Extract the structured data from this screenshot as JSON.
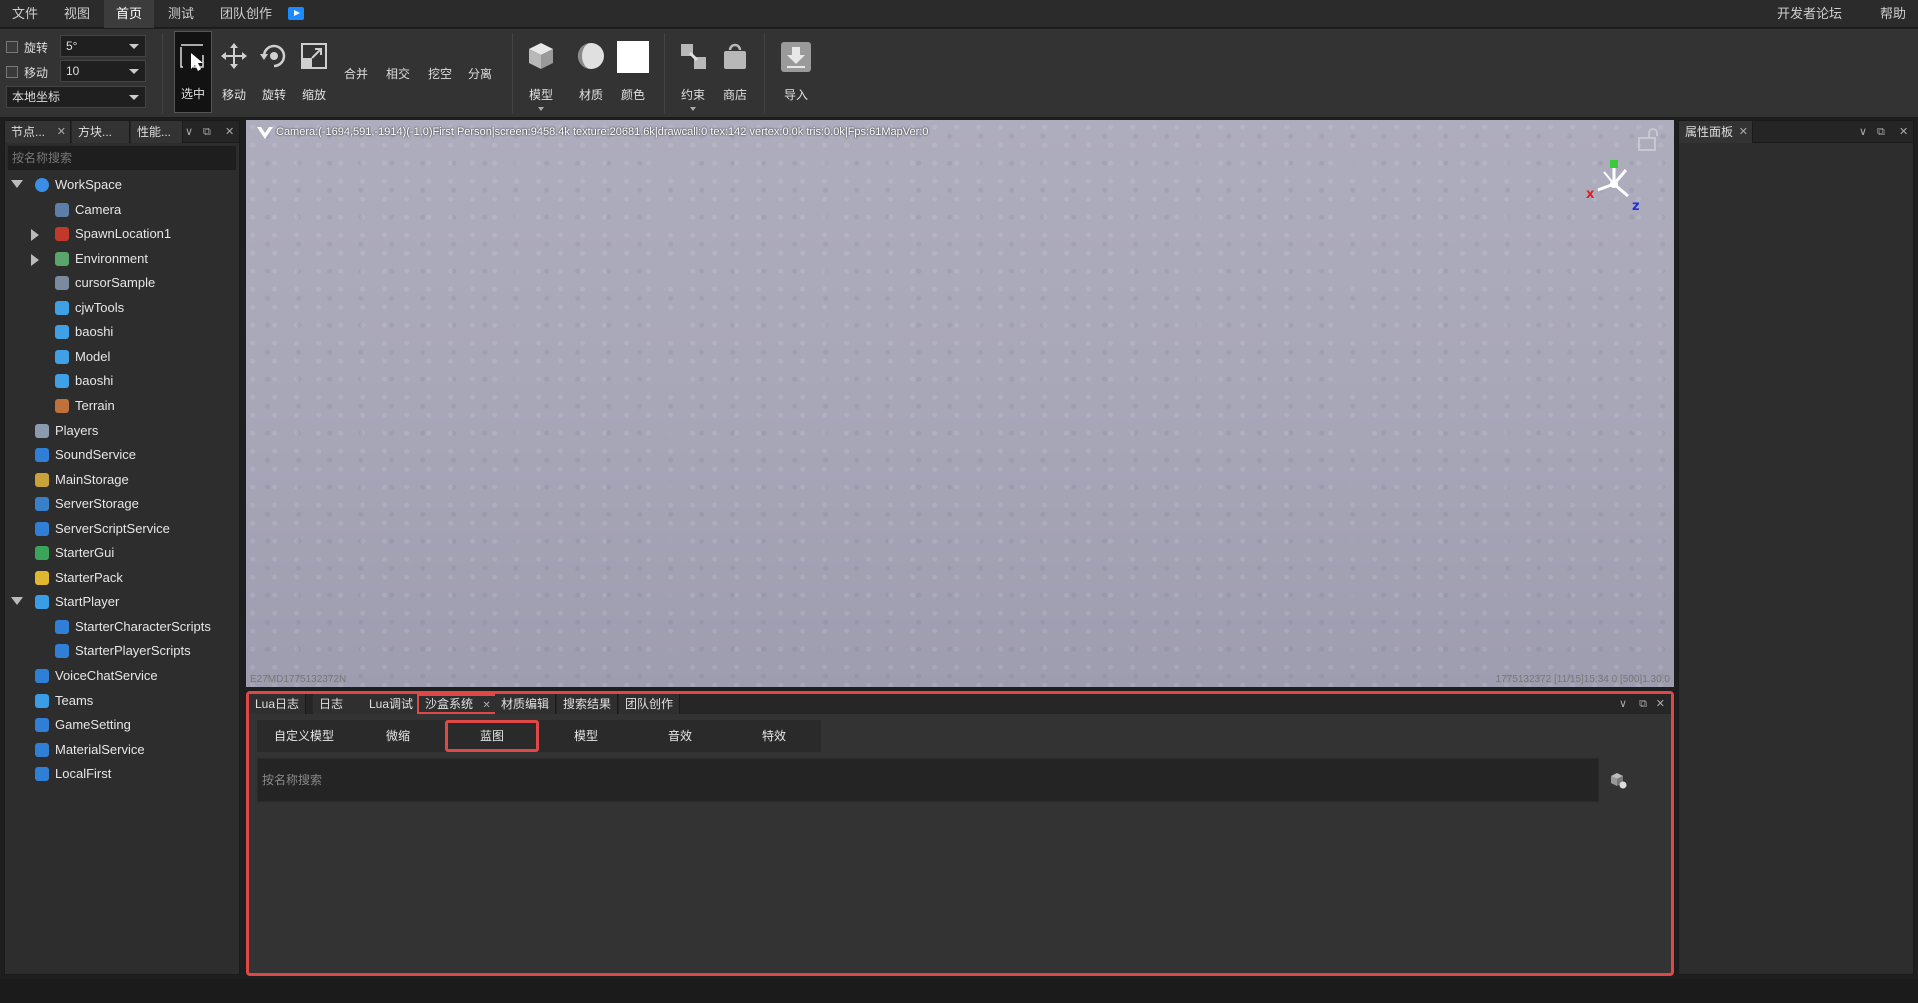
{
  "menu": {
    "file": "文件",
    "view": "视图",
    "home": "首页",
    "test": "测试",
    "team": "团队创作",
    "forum": "开发者论坛",
    "help": "帮助"
  },
  "toolbar": {
    "rotate_label": "旋转",
    "rotate_value": "5°",
    "move_label": "移动",
    "move_value": "10",
    "coord_value": "本地坐标",
    "select": "选中",
    "move": "移动",
    "rotate": "旋转",
    "scale": "缩放",
    "union": "合并",
    "intersect": "相交",
    "negate": "挖空",
    "separate": "分离",
    "model": "模型",
    "material": "材质",
    "color": "颜色",
    "constraint": "约束",
    "store": "商店",
    "import": "导入"
  },
  "left_panel": {
    "tabs": [
      "节点...",
      "方块...",
      "性能..."
    ],
    "search_placeholder": "按名称搜索",
    "tree": [
      {
        "label": "WorkSpace",
        "level": 0,
        "twisty": "down",
        "icon": "globe-icon",
        "color": "#3a8ee6"
      },
      {
        "label": "Camera",
        "level": 1,
        "twisty": "",
        "icon": "camera-icon",
        "color": "#5b7fa8"
      },
      {
        "label": "SpawnLocation1",
        "level": 1,
        "twisty": "right",
        "icon": "spawn-icon",
        "color": "#c0392b"
      },
      {
        "label": "Environment",
        "level": 1,
        "twisty": "right",
        "icon": "mountain-icon",
        "color": "#5aa56b"
      },
      {
        "label": "cursorSample",
        "level": 1,
        "twisty": "",
        "icon": "model-icon",
        "color": "#7a8ba0"
      },
      {
        "label": "cjwTools",
        "level": 1,
        "twisty": "",
        "icon": "folder-icon",
        "color": "#3fa0e6"
      },
      {
        "label": "baoshi",
        "level": 1,
        "twisty": "",
        "icon": "folder-icon",
        "color": "#3fa0e6"
      },
      {
        "label": "Model",
        "level": 1,
        "twisty": "",
        "icon": "folder-icon",
        "color": "#3fa0e6"
      },
      {
        "label": "baoshi",
        "level": 1,
        "twisty": "",
        "icon": "folder-icon",
        "color": "#3fa0e6"
      },
      {
        "label": "Terrain",
        "level": 1,
        "twisty": "",
        "icon": "terrain-icon",
        "color": "#c0703a"
      },
      {
        "label": "Players",
        "level": 0,
        "twisty": "",
        "icon": "players-icon",
        "color": "#8a9bb0"
      },
      {
        "label": "SoundService",
        "level": 0,
        "twisty": "",
        "icon": "sound-icon",
        "color": "#2f7fd6"
      },
      {
        "label": "MainStorage",
        "level": 0,
        "twisty": "",
        "icon": "storage-icon",
        "color": "#c9a23a"
      },
      {
        "label": "ServerStorage",
        "level": 0,
        "twisty": "",
        "icon": "server-storage-icon",
        "color": "#3a7fc9"
      },
      {
        "label": "ServerScriptService",
        "level": 0,
        "twisty": "",
        "icon": "script-service-icon",
        "color": "#2f7fd6"
      },
      {
        "label": "StarterGui",
        "level": 0,
        "twisty": "",
        "icon": "gui-icon",
        "color": "#3aa55a"
      },
      {
        "label": "StarterPack",
        "level": 0,
        "twisty": "",
        "icon": "pack-icon",
        "color": "#e0b830"
      },
      {
        "label": "StartPlayer",
        "level": 0,
        "twisty": "down",
        "icon": "player-icon",
        "color": "#3a9ee6"
      },
      {
        "label": "StarterCharacterScripts",
        "level": 1,
        "twisty": "",
        "icon": "script-icon",
        "color": "#2f7fd6"
      },
      {
        "label": "StarterPlayerScripts",
        "level": 1,
        "twisty": "",
        "icon": "script-icon",
        "color": "#2f7fd6"
      },
      {
        "label": "VoiceChatService",
        "level": 0,
        "twisty": "",
        "icon": "voice-icon",
        "color": "#2f7fd6"
      },
      {
        "label": "Teams",
        "level": 0,
        "twisty": "",
        "icon": "teams-icon",
        "color": "#3a9ee6"
      },
      {
        "label": "GameSetting",
        "level": 0,
        "twisty": "",
        "icon": "setting-icon",
        "color": "#2f7fd6"
      },
      {
        "label": "MaterialService",
        "level": 0,
        "twisty": "",
        "icon": "material-icon",
        "color": "#2f7fd6"
      },
      {
        "label": "LocalFirst",
        "level": 0,
        "twisty": "",
        "icon": "local-icon",
        "color": "#2f7fd6"
      }
    ]
  },
  "viewport": {
    "status": "Camera:(-1694,591,-1914)(-1,0)First Person|screen:9458.4k texture:20681.6k|drawcall:0 tex:142 vertex:0.0k tris:0.0k|Fps:61MapVer:0",
    "bottom_left": "E27MD1775132372N",
    "bottom_right": "1775132372   [11/15]15:34 0   [500]1.30.0"
  },
  "bottom_panel": {
    "tabs": [
      "Lua日志",
      "日志",
      "Lua调试",
      "沙盒系统",
      "材质编辑",
      "搜索结果",
      "团队创作"
    ],
    "sub_tabs": [
      "自定义模型",
      "微缩",
      "蓝图",
      "模型",
      "音效",
      "特效"
    ],
    "search_placeholder": "按名称搜索"
  },
  "right_panel": {
    "tab": "属性面板"
  }
}
